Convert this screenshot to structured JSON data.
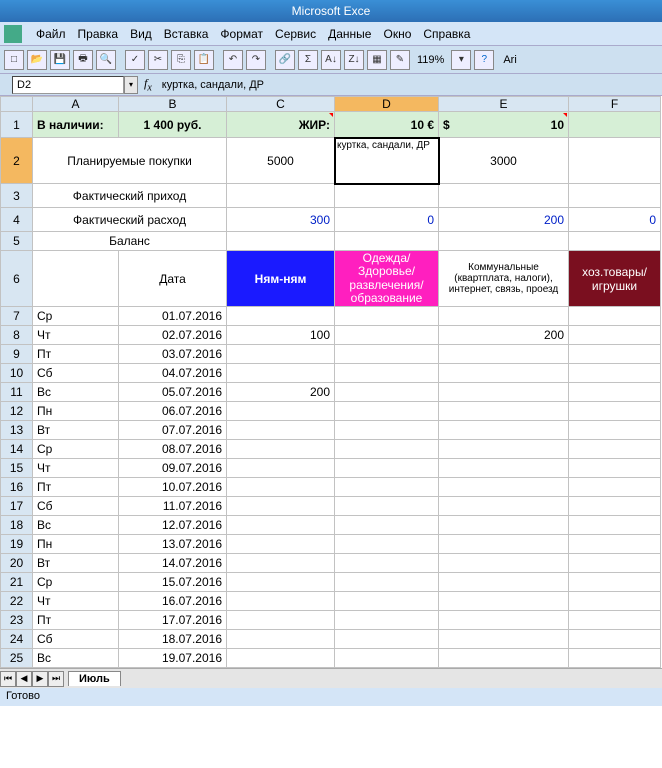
{
  "titlebar": "Microsoft Exce",
  "menu": [
    "Файл",
    "Правка",
    "Вид",
    "Вставка",
    "Формат",
    "Сервис",
    "Данные",
    "Окно",
    "Справка"
  ],
  "zoom": "119%",
  "fontBox": "Ari",
  "namebox": "D2",
  "formula": "куртка, сандали, ДР",
  "cols": [
    "",
    "A",
    "B",
    "C",
    "D",
    "E",
    "F"
  ],
  "rows": {
    "1": {
      "A": "В наличии:",
      "B": "1 400 руб.",
      "C": "ЖИР:",
      "D": "10 €",
      "E": "$",
      "Eval": "10"
    },
    "2": {
      "AB": "Планируемые покупки",
      "C": "5000",
      "D": "куртка, сандали, ДР",
      "E": "3000"
    },
    "3": {
      "AB": "Фактический приход"
    },
    "4": {
      "AB": "Фактический расход",
      "C": "300",
      "D": "0",
      "E": "200",
      "F": "0"
    },
    "5": {
      "AB": "Баланс"
    },
    "6": {
      "B": "Дата",
      "C": "Ням-ням",
      "D": "Одежда/Здоровье/развлечения/образование",
      "E": "Коммунальные (квартплата, налоги), интернет, связь, проезд",
      "F": "хоз.товары/игрушки"
    }
  },
  "dataRows": [
    {
      "n": "7",
      "A": "Ср",
      "B": "01.07.2016",
      "C": "",
      "E": ""
    },
    {
      "n": "8",
      "A": "Чт",
      "B": "02.07.2016",
      "C": "100",
      "E": "200"
    },
    {
      "n": "9",
      "A": "Пт",
      "B": "03.07.2016",
      "C": "",
      "E": ""
    },
    {
      "n": "10",
      "A": "Сб",
      "B": "04.07.2016",
      "C": "",
      "E": ""
    },
    {
      "n": "11",
      "A": "Вс",
      "B": "05.07.2016",
      "C": "200",
      "E": ""
    },
    {
      "n": "12",
      "A": "Пн",
      "B": "06.07.2016",
      "C": "",
      "E": ""
    },
    {
      "n": "13",
      "A": "Вт",
      "B": "07.07.2016",
      "C": "",
      "E": ""
    },
    {
      "n": "14",
      "A": "Ср",
      "B": "08.07.2016",
      "C": "",
      "E": ""
    },
    {
      "n": "15",
      "A": "Чт",
      "B": "09.07.2016",
      "C": "",
      "E": ""
    },
    {
      "n": "16",
      "A": "Пт",
      "B": "10.07.2016",
      "C": "",
      "E": ""
    },
    {
      "n": "17",
      "A": "Сб",
      "B": "11.07.2016",
      "C": "",
      "E": ""
    },
    {
      "n": "18",
      "A": "Вс",
      "B": "12.07.2016",
      "C": "",
      "E": ""
    },
    {
      "n": "19",
      "A": "Пн",
      "B": "13.07.2016",
      "C": "",
      "E": ""
    },
    {
      "n": "20",
      "A": "Вт",
      "B": "14.07.2016",
      "C": "",
      "E": ""
    },
    {
      "n": "21",
      "A": "Ср",
      "B": "15.07.2016",
      "C": "",
      "E": ""
    },
    {
      "n": "22",
      "A": "Чт",
      "B": "16.07.2016",
      "C": "",
      "E": ""
    },
    {
      "n": "23",
      "A": "Пт",
      "B": "17.07.2016",
      "C": "",
      "E": ""
    },
    {
      "n": "24",
      "A": "Сб",
      "B": "18.07.2016",
      "C": "",
      "E": ""
    },
    {
      "n": "25",
      "A": "Вс",
      "B": "19.07.2016",
      "C": "",
      "E": ""
    }
  ],
  "tab": "Июль",
  "status": "Готово"
}
